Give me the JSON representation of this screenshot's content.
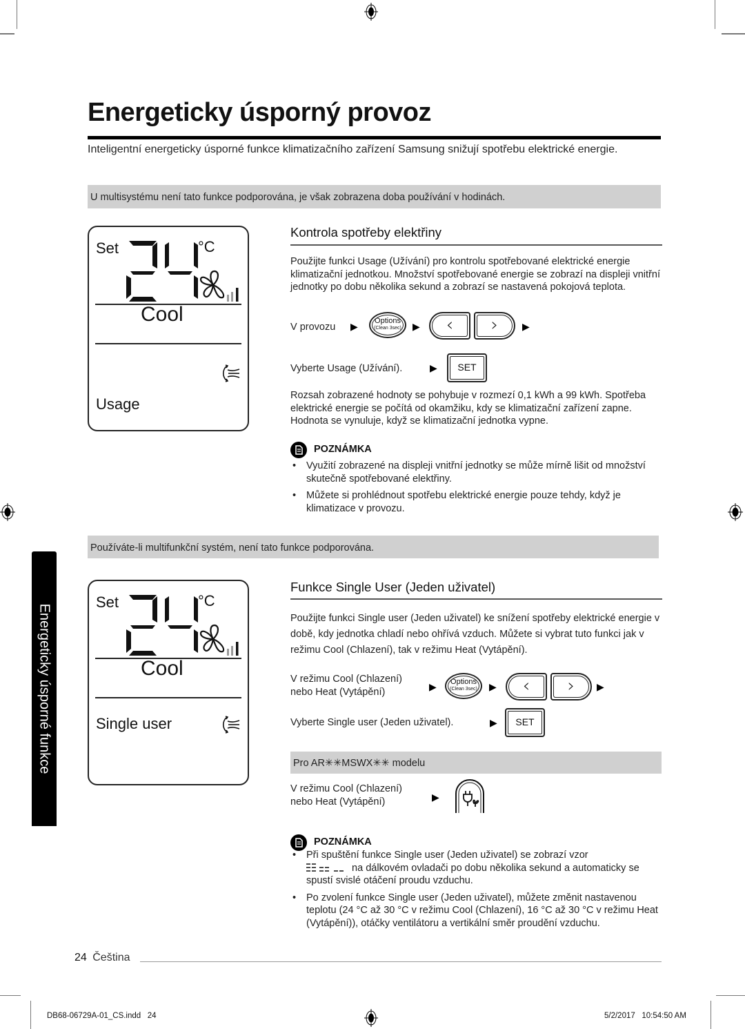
{
  "page": {
    "title": "Energeticky úsporný provoz",
    "intro": "Inteligentní energeticky úsporné funkce klimatizačního zařízení Samsung snižují spotřebu elektrické energie.",
    "side_tab": "Energeticky úsporné funkce"
  },
  "notice_multisystem": "U multisystému není tato funkce podporována, je však zobrazena doba používání v hodinách.",
  "display_usage": {
    "set": "Set",
    "temp": "24",
    "unit": "°C",
    "mode": "Cool",
    "function": "Usage",
    "icons": [
      "fan-icon",
      "fan-speed-bars-icon",
      "airflow-swing-icon"
    ]
  },
  "section_usage": {
    "heading": "Kontrola spotřeby elektřiny",
    "description": "Použijte funkci Usage (Užívání) pro kontrolu spotřebované elektrické energie klimatizační jednotkou. Množství spotřebované energie se zobrazí na displeji vnitřní jednotky po dobu několika sekund a zobrazí se nastavená pokojová teplota.",
    "step1_label": "V provozu",
    "step2_label": "Vyberte Usage (Užívání).",
    "range_text": "Rozsah zobrazené hodnoty se pohybuje v rozmezí 0,1 kWh a 99 kWh. Spotřeba elektrické energie se počítá od okamžiku, kdy se klimatizační zařízení zapne. Hodnota se vynuluje, když se klimatizační jednotka vypne.",
    "note_heading": "POZNÁMKA",
    "notes": [
      "Využití zobrazené na displeji vnitřní jednotky se může mírně lišit od množství skutečně spotřebované elektřiny.",
      "Můžete si prohlédnout spotřebu elektrické energie pouze tehdy, když je klimatizace v provozu."
    ]
  },
  "remote_buttons": {
    "options": "Options",
    "options_sub": "(Clean 3sec)",
    "left": "‹",
    "right": "›",
    "set": "SET",
    "arrow": "▶"
  },
  "notice_multifunction": "Používáte-li multifunkční systém, není tato funkce podporována.",
  "display_single": {
    "set": "Set",
    "temp": "24",
    "unit": "°C",
    "mode": "Cool",
    "function": "Single user"
  },
  "section_single": {
    "heading": "Funkce Single User (Jeden uživatel)",
    "description": "Použijte funkci Single user (Jeden uživatel) ke snížení spotřeby elektrické energie v době, kdy jednotka chladí nebo ohřívá vzduch. Můžete si vybrat tuto funkci jak v režimu Cool (Chlazení), tak v režimu Heat (Vytápění).",
    "step1_line1": "V režimu Cool (Chlazení)",
    "step1_line2": "nebo Heat (Vytápění)",
    "step2_label": "Vyberte Single user (Jeden uživatel).",
    "model_bar": "Pro AR✳✳MSWX✳✳ modelu",
    "step3_line1": "V režimu Cool (Chlazení)",
    "step3_line2": "nebo Heat (Vytápění)",
    "note_heading": "POZNÁMKA",
    "note1_a": "Při spuštění funkce Single user (Jeden uživatel) se zobrazí vzor",
    "note1_b": "na dálkovém ovladači po dobu několika sekund a automaticky se spustí svislé otáčení proudu vzduchu.",
    "note2": "Po zvolení funkce Single user (Jeden uživatel), můžete změnit nastavenou teplotu (24 °C až 30 °C v režimu Cool (Chlazení), 16 °C až 30 °C v režimu Heat (Vytápění)), otáčky ventilátoru a vertikální směr proudění vzduchu."
  },
  "footer": {
    "page_number": "24",
    "language": "Čeština",
    "slug_file": "DB68-06729A-01_CS.indd   24",
    "slug_date": "5/2/2017   10:54:50 AM"
  }
}
